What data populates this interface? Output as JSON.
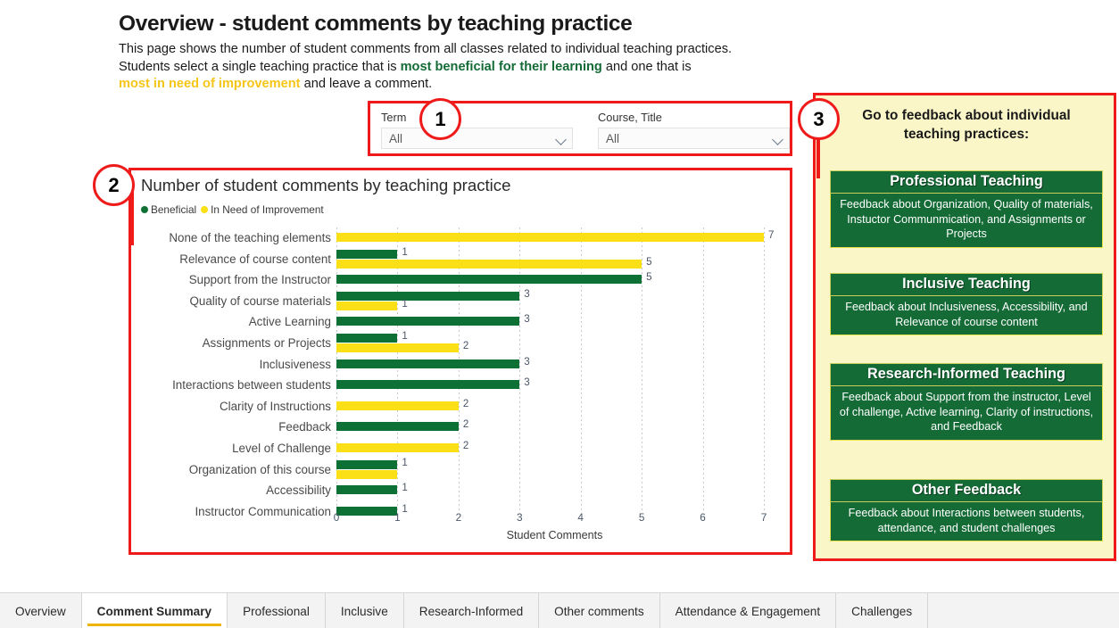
{
  "header": {
    "title": "Overview - student comments by teaching practice",
    "intro_line1": "This page shows the number of student comments from all classes related to individual teaching practices.",
    "intro_line2_a": "Students select a single teaching practice that is ",
    "intro_line2_b": "most beneficial for their learning",
    "intro_line2_c": " and one that is",
    "intro_line3_a": "most in need of improvement",
    "intro_line3_b": " and leave a comment."
  },
  "callouts": {
    "one": "1",
    "two": "2",
    "three": "3"
  },
  "filters": {
    "term": {
      "label": "Term",
      "value": "All"
    },
    "course": {
      "label": "Course, Title",
      "value": "All"
    }
  },
  "chart_data": {
    "type": "bar",
    "title": "Number of student comments by teaching practice",
    "orientation": "horizontal",
    "xlabel": "Student Comments",
    "ylabel": "",
    "xlim": [
      0,
      7
    ],
    "xticks": [
      "0",
      "1",
      "2",
      "3",
      "4",
      "5",
      "6",
      "7"
    ],
    "grid": true,
    "legend_position": "top-left",
    "categories": [
      "None of the teaching elements",
      "Relevance of course content",
      "Support from the Instructor",
      "Quality of course materials",
      "Active Learning",
      "Assignments or Projects",
      "Inclusiveness",
      "Interactions between students",
      "Clarity of Instructions",
      "Feedback",
      "Level of Challenge",
      "Organization of this course",
      "Accessibility",
      "Instructor Communication"
    ],
    "series": [
      {
        "name": "Beneficial",
        "color": "#0d7034",
        "values": [
          0,
          1,
          5,
          3,
          3,
          1,
          3,
          3,
          0,
          2,
          0,
          1,
          1,
          1
        ]
      },
      {
        "name": "In Need of Improvement",
        "color": "#fbdf17",
        "values": [
          7,
          5,
          0,
          1,
          0,
          2,
          0,
          0,
          2,
          0,
          2,
          1,
          0,
          0
        ]
      }
    ],
    "hidden_labels": [
      {
        "category": "Organization of this course",
        "series": "In Need of Improvement"
      }
    ]
  },
  "nav_panel": {
    "heading_line1": "Go to feedback about individual",
    "heading_line2": "teaching practices:",
    "cards": [
      {
        "title": "Professional Teaching",
        "body": "Feedback about Organization, Quality of materials, Instuctor Communmication, and Assignments or Projects"
      },
      {
        "title": "Inclusive Teaching",
        "body": "Feedback about Inclusiveness, Accessibility, and Relevance of course content"
      },
      {
        "title": "Research-Informed Teaching",
        "body": "Feedback about Support from the instructor, Level of challenge, Active learning, Clarity of instructions, and Feedback"
      },
      {
        "title": "Other Feedback",
        "body": "Feedback about Interactions between students, attendance, and student challenges"
      }
    ]
  },
  "tabs": [
    {
      "label": "Overview",
      "active": false
    },
    {
      "label": "Comment Summary",
      "active": true
    },
    {
      "label": "Professional",
      "active": false
    },
    {
      "label": "Inclusive",
      "active": false
    },
    {
      "label": "Research-Informed",
      "active": false
    },
    {
      "label": "Other comments",
      "active": false
    },
    {
      "label": "Attendance & Engagement",
      "active": false
    },
    {
      "label": "Challenges",
      "active": false
    }
  ],
  "colors": {
    "beneficial": "#0d7034",
    "improvement": "#fbdf17",
    "callout_red": "#ef1b1b",
    "panel_bg": "#faf6c8",
    "tab_accent": "#f0b400"
  }
}
